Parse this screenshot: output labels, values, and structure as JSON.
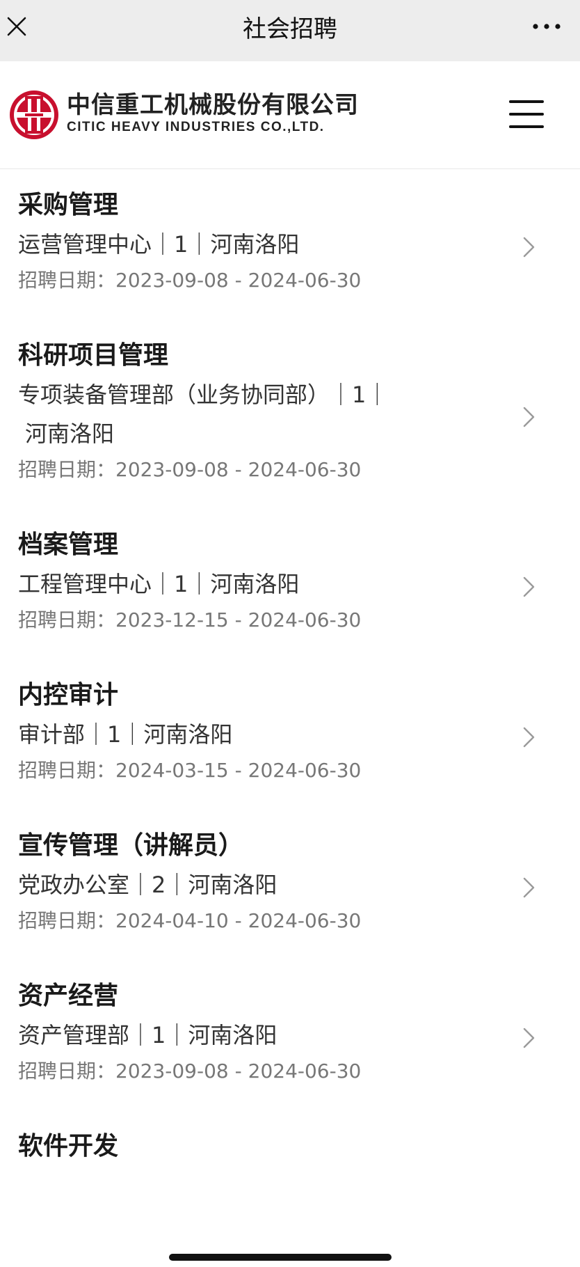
{
  "topbar": {
    "title": "社会招聘",
    "close_icon": "close-icon",
    "more_icon": "more-icon"
  },
  "header": {
    "company_name_cn": "中信重工机械股份有限公司",
    "company_name_en": "CITIC HEAVY INDUSTRIES CO.,LTD.",
    "logo_icon": "citic-logo-icon",
    "menu_icon": "hamburger-menu-icon",
    "brand_color": "#c8102e"
  },
  "jobs": [
    {
      "title": "采购管理",
      "meta_lines": [
        "运营管理中心｜1｜河南洛阳"
      ],
      "date": "招聘日期：2023-09-08 - 2024-06-30"
    },
    {
      "title": "科研项目管理",
      "meta_lines": [
        "专项装备管理部（业务协同部）｜1｜",
        "河南洛阳"
      ],
      "date": "招聘日期：2023-09-08 - 2024-06-30"
    },
    {
      "title": "档案管理",
      "meta_lines": [
        "工程管理中心｜1｜河南洛阳"
      ],
      "date": "招聘日期：2023-12-15 - 2024-06-30"
    },
    {
      "title": "内控审计",
      "meta_lines": [
        "审计部｜1｜河南洛阳"
      ],
      "date": "招聘日期：2024-03-15 - 2024-06-30"
    },
    {
      "title": "宣传管理（讲解员）",
      "meta_lines": [
        "党政办公室｜2｜河南洛阳"
      ],
      "date": "招聘日期：2024-04-10 - 2024-06-30"
    },
    {
      "title": "资产经营",
      "meta_lines": [
        "资产管理部｜1｜河南洛阳"
      ],
      "date": "招聘日期：2023-09-08 - 2024-06-30"
    },
    {
      "title": "软件开发",
      "meta_lines": [],
      "date": ""
    }
  ]
}
